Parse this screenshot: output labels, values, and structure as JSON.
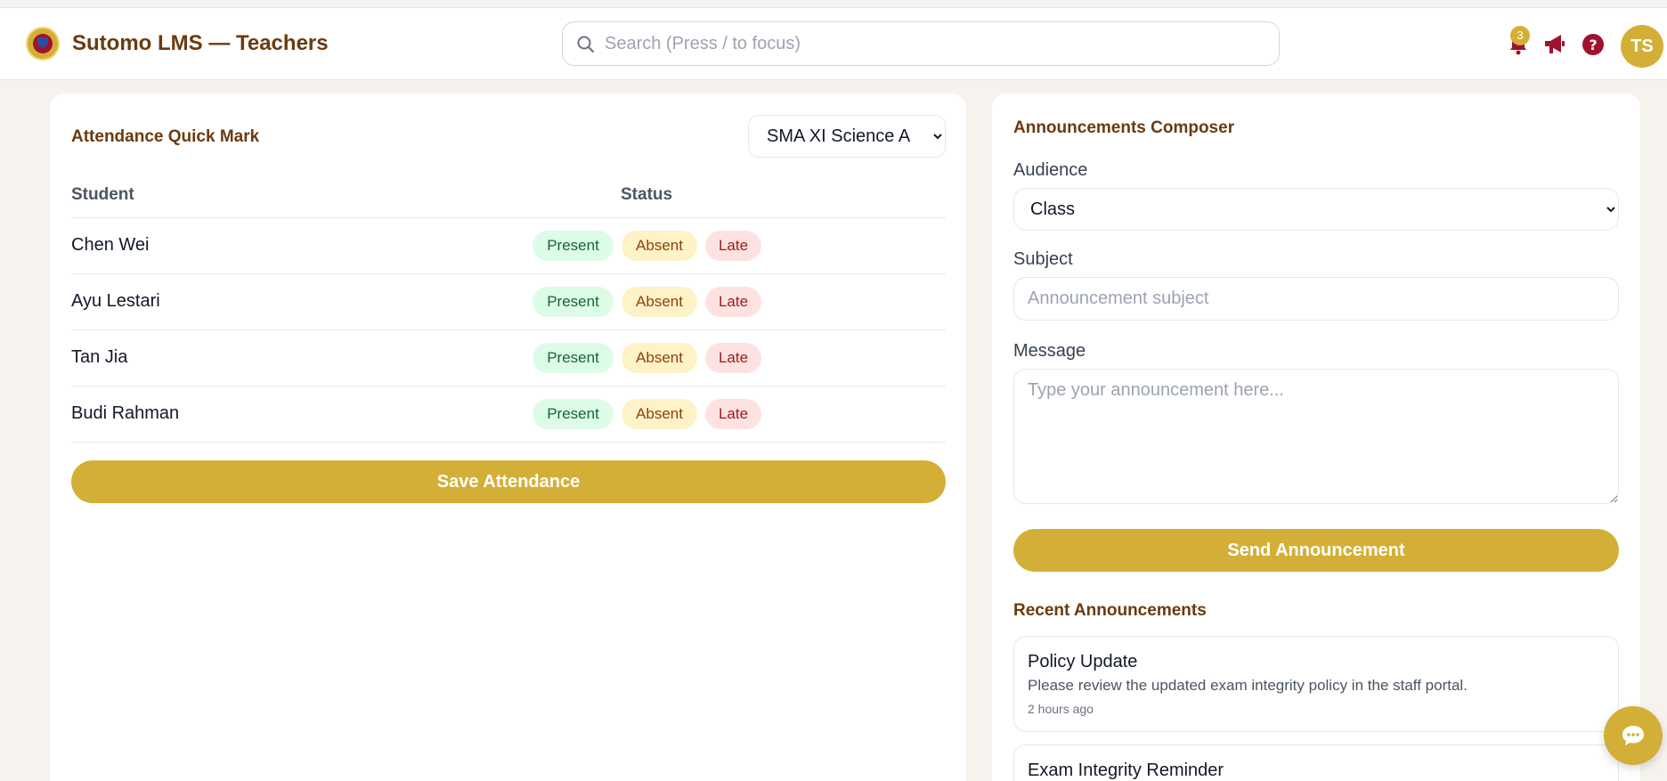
{
  "header": {
    "brand": "Sutomo LMS — Teachers",
    "search_placeholder": "Search (Press / to focus)",
    "notification_count": "3",
    "avatar_initials": "TS",
    "icons": [
      "search-icon",
      "bell-icon",
      "megaphone-icon",
      "help-icon"
    ]
  },
  "attendance": {
    "title": "Attendance Quick Mark",
    "class_selected": "SMA XI Science A",
    "columns": [
      "Student",
      "Status"
    ],
    "students": [
      {
        "name": "Chen Wei"
      },
      {
        "name": "Ayu Lestari"
      },
      {
        "name": "Tan Jia"
      },
      {
        "name": "Budi Rahman"
      }
    ],
    "status_options": [
      "Present",
      "Absent",
      "Late"
    ],
    "save_label": "Save Attendance"
  },
  "composer": {
    "title": "Announcements Composer",
    "audience_label": "Audience",
    "audience_selected": "Class",
    "subject_label": "Subject",
    "subject_placeholder": "Announcement subject",
    "message_label": "Message",
    "message_placeholder": "Type your announcement here...",
    "send_label": "Send Announcement"
  },
  "recent": {
    "title": "Recent Announcements",
    "items": [
      {
        "title": "Policy Update",
        "body": "Please review the updated exam integrity policy in the staff portal.",
        "time": "2 hours ago"
      },
      {
        "title": "Exam Integrity Reminder",
        "body": "",
        "time": ""
      }
    ]
  },
  "colors": {
    "accent_gold": "#d4af37",
    "brand_brown": "#6b3a0f",
    "icon_maroon": "#a0122d"
  }
}
